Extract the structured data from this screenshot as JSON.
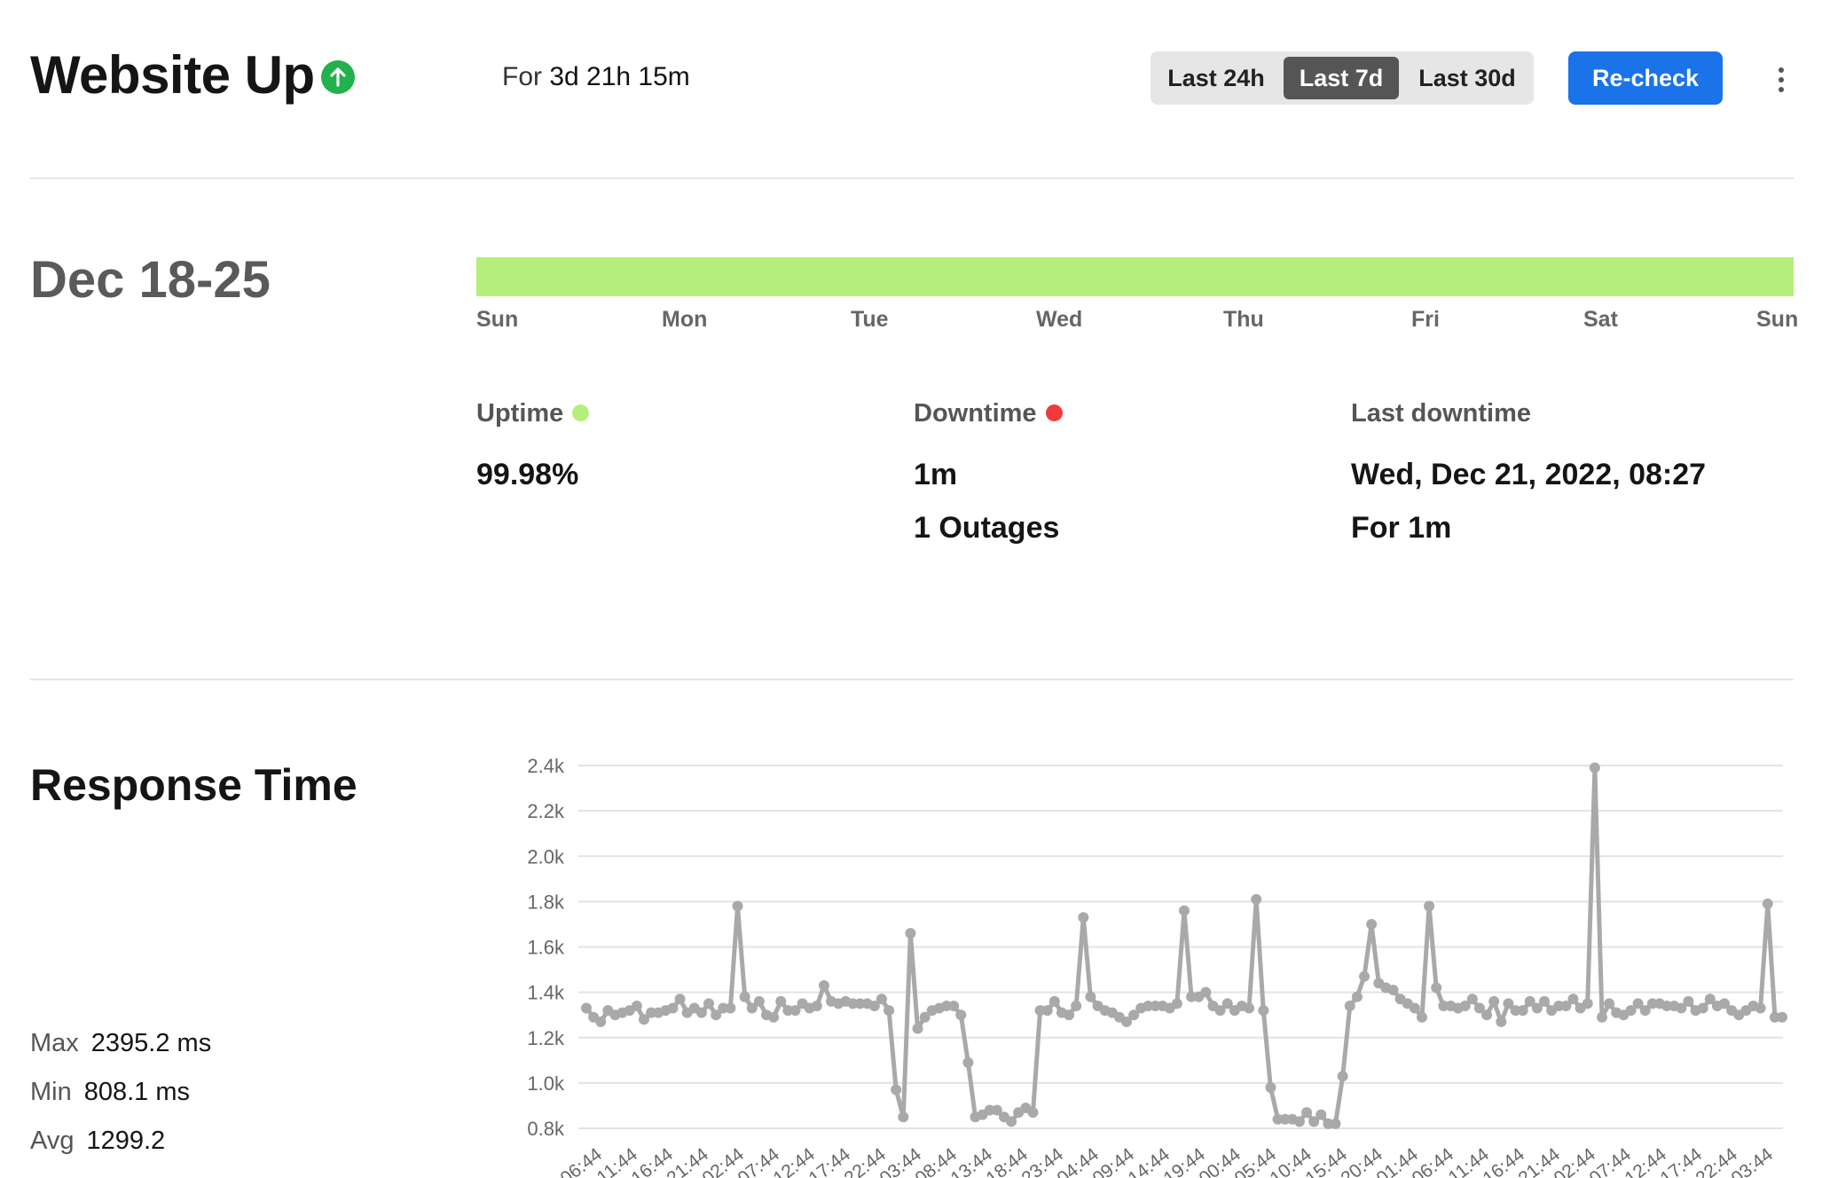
{
  "header": {
    "title": "Website Up",
    "status_color": "#22b14c",
    "status_icon": "arrow-up-circle-icon",
    "for_prefix": "For",
    "for_value": "3d 21h 15m",
    "ranges": [
      "Last 24h",
      "Last 7d",
      "Last 30d"
    ],
    "active_range": "Last 7d",
    "recheck_label": "Re-check",
    "menu_icon": "more-vertical-icon"
  },
  "week": {
    "date_range": "Dec 18-25",
    "bar_color": "#b4ef7b",
    "days": [
      "Sun",
      "Mon",
      "Tue",
      "Wed",
      "Thu",
      "Fri",
      "Sat",
      "Sun"
    ]
  },
  "stats": {
    "uptime": {
      "label": "Uptime",
      "value": "99.98%",
      "color": "#b4ef7b"
    },
    "downtime": {
      "label": "Downtime",
      "value": "1m",
      "outages": "1 Outages",
      "color": "#ef3b3b"
    },
    "last_downtime": {
      "label": "Last downtime",
      "value": "Wed, Dec 21, 2022, 08:27",
      "duration": "For 1m"
    }
  },
  "response": {
    "title": "Response Time",
    "max_label": "Max",
    "max_value": "2395.2 ms",
    "min_label": "Min",
    "min_value": "808.1 ms",
    "avg_label": "Avg",
    "avg_value": "1299.2"
  },
  "chart_data": {
    "type": "line",
    "ylim": [
      800,
      2400
    ],
    "yticks": [
      "0.8k",
      "1.0k",
      "1.2k",
      "1.4k",
      "1.6k",
      "1.8k",
      "2.0k",
      "2.2k",
      "2.4k"
    ],
    "xtick_labels": [
      "06:44",
      "11:44",
      "16:44",
      "21:44",
      "02:44",
      "07:44",
      "12:44",
      "17:44",
      "22:44",
      "03:44",
      "08:44",
      "13:44",
      "18:44",
      "23:44",
      "04:44",
      "09:44",
      "14:44",
      "19:44",
      "00:44",
      "05:44",
      "10:44",
      "15:44",
      "20:44",
      "01:44",
      "06:44",
      "11:44",
      "16:44",
      "21:44",
      "02:44",
      "07:44",
      "12:44",
      "17:44",
      "22:44",
      "03:44"
    ],
    "line_color": "#a9a9a9",
    "grid": true,
    "values": [
      1330,
      1290,
      1270,
      1320,
      1300,
      1310,
      1320,
      1340,
      1280,
      1310,
      1310,
      1320,
      1330,
      1370,
      1310,
      1330,
      1310,
      1350,
      1300,
      1330,
      1330,
      1780,
      1380,
      1330,
      1360,
      1300,
      1290,
      1360,
      1320,
      1320,
      1350,
      1330,
      1340,
      1430,
      1360,
      1350,
      1360,
      1350,
      1350,
      1350,
      1340,
      1370,
      1320,
      970,
      850,
      1660,
      1240,
      1290,
      1320,
      1330,
      1340,
      1340,
      1300,
      1090,
      850,
      860,
      880,
      880,
      850,
      830,
      870,
      890,
      870,
      1320,
      1320,
      1360,
      1310,
      1300,
      1340,
      1730,
      1380,
      1340,
      1320,
      1310,
      1290,
      1270,
      1300,
      1330,
      1340,
      1340,
      1340,
      1330,
      1350,
      1760,
      1380,
      1380,
      1400,
      1340,
      1320,
      1350,
      1320,
      1340,
      1330,
      1810,
      1320,
      980,
      840,
      840,
      840,
      830,
      870,
      830,
      860,
      820,
      820,
      1030,
      1340,
      1380,
      1470,
      1700,
      1440,
      1420,
      1410,
      1370,
      1350,
      1330,
      1290,
      1780,
      1420,
      1340,
      1340,
      1330,
      1340,
      1370,
      1330,
      1300,
      1360,
      1270,
      1350,
      1320,
      1320,
      1360,
      1330,
      1360,
      1320,
      1340,
      1340,
      1370,
      1330,
      1350,
      2390,
      1290,
      1350,
      1310,
      1300,
      1320,
      1350,
      1320,
      1350,
      1350,
      1340,
      1340,
      1330,
      1360,
      1320,
      1330,
      1370,
      1340,
      1350,
      1320,
      1300,
      1320,
      1340,
      1330,
      1790,
      1290,
      1290
    ]
  }
}
